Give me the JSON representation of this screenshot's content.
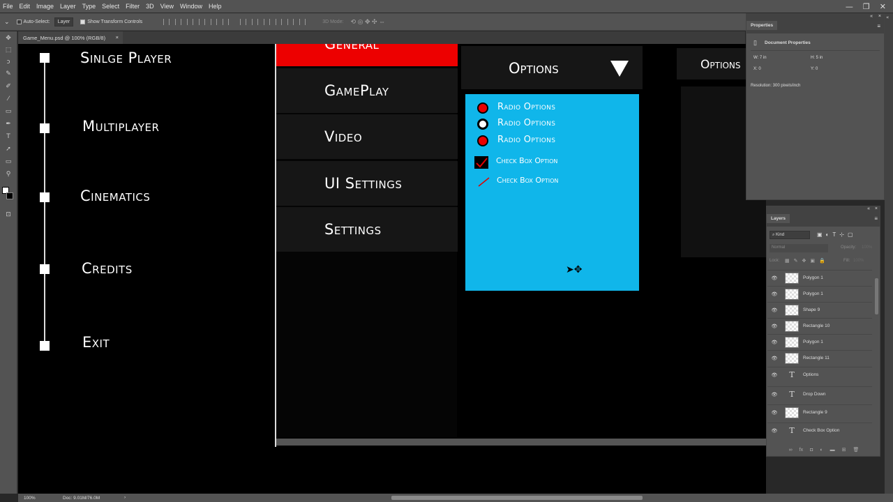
{
  "menubar": [
    "File",
    "Edit",
    "Image",
    "Layer",
    "Type",
    "Select",
    "Filter",
    "3D",
    "View",
    "Window",
    "Help"
  ],
  "options": {
    "auto_select": "Auto-Select:",
    "layer_select": "Layer",
    "transform": "Show Transform Controls",
    "mode_3d": "3D Mode:"
  },
  "document": {
    "tab": "Game_Menu.psd @ 100% (RGB/8)"
  },
  "game_menu": {
    "main": [
      "Sinlge Player",
      "Multiplayer",
      "Cinematics",
      "Credits",
      "Exit"
    ],
    "sections": [
      "General",
      "GamePlay",
      "Video",
      "UI Settings",
      "Settings"
    ],
    "options_header": "Options",
    "radio_options": [
      "Radio Options",
      "Radio Options",
      "Radio Options"
    ],
    "checkbox_options": [
      "Check Box Option",
      "Check Box Option"
    ],
    "right_header": "Options"
  },
  "properties": {
    "title": "Properties",
    "doc_props": "Document Properties",
    "w": "W:  7 in",
    "h": "H:  5 in",
    "x": "X:  0",
    "y": "Y:  0",
    "resolution": "Resolution: 300 pixels/inch"
  },
  "layers": {
    "title": "Layers",
    "filter": "Kind",
    "blend": "Normal",
    "opacity": "Opacity:",
    "opacity_val": "100%",
    "lock": "Lock:",
    "fill": "Fill:",
    "fill_val": "100%",
    "items": [
      {
        "name": "Polygon 1",
        "type": "shape"
      },
      {
        "name": "Polygon 1",
        "type": "shape"
      },
      {
        "name": "Shape 9",
        "type": "shape"
      },
      {
        "name": "Rectangle 10",
        "type": "shape"
      },
      {
        "name": "Polygon 1",
        "type": "shape"
      },
      {
        "name": "Rectangle 11",
        "type": "shape"
      },
      {
        "name": "Options",
        "type": "text"
      },
      {
        "name": "Drop Down",
        "type": "text"
      },
      {
        "name": "Rectangle 9",
        "type": "shape"
      },
      {
        "name": "Check Box Option",
        "type": "text"
      }
    ]
  },
  "status": {
    "zoom": "100%",
    "doc": "Doc: 9.01M/76.0M"
  },
  "colors": {
    "accent_red": "#ed0000",
    "dropdown_blue": "#10b6ea",
    "ps_panel": "#535353"
  },
  "icons": [
    "move-icon",
    "marquee-icon",
    "lasso-icon",
    "quick-select-icon",
    "crop-icon",
    "eyedropper-icon",
    "brush-icon",
    "eraser-icon",
    "gradient-icon",
    "pen-icon",
    "type-icon",
    "path-select-icon",
    "shape-icon",
    "zoom-icon",
    "eye-icon",
    "text-layer-icon",
    "move-cursor-icon"
  ]
}
